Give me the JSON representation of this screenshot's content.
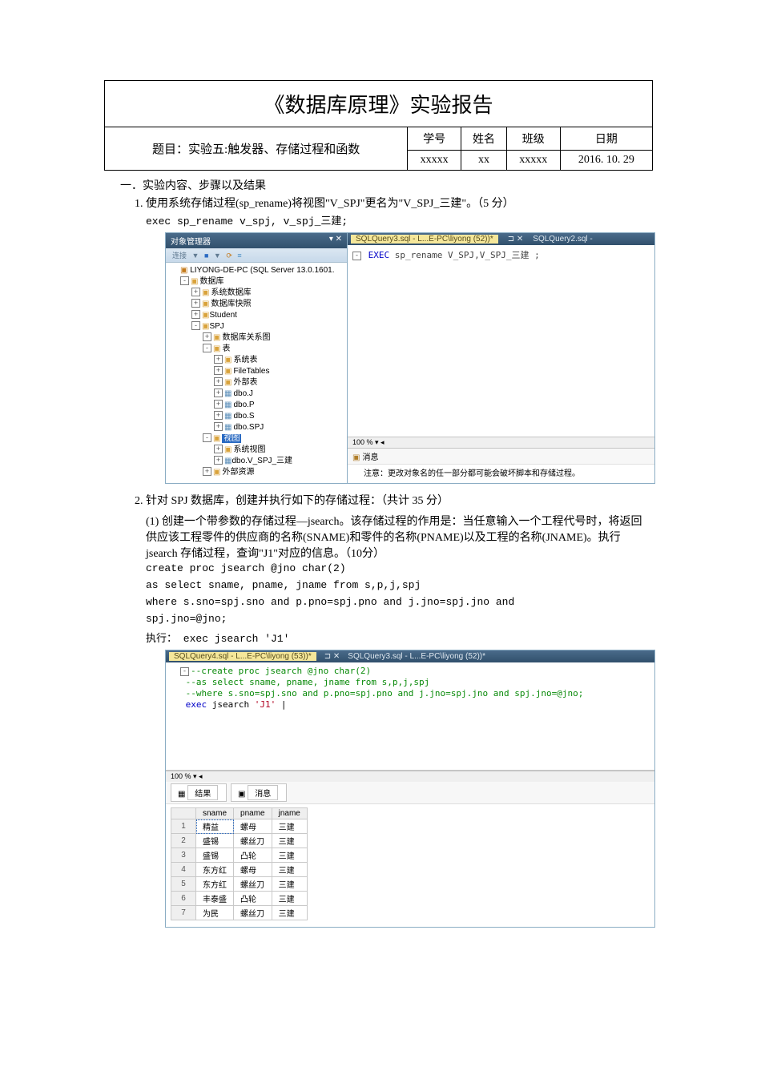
{
  "report": {
    "title": "《数据库原理》实验报告",
    "topic_label": "题目：实验五:触发器、存储过程和函数",
    "col_id": "学号",
    "col_name": "姓名",
    "col_class": "班级",
    "col_date": "日期",
    "val_id": "xxxxx",
    "val_name": "xx",
    "val_class": "xxxxx",
    "val_date": "2016. 10. 29"
  },
  "section1": "一．实验内容、步骤以及结果",
  "q1": {
    "text": "使用系统存储过程(sp_rename)将视图\"V_SPJ\"更名为\"V_SPJ_三建\"。（5 分）",
    "code": "exec sp_rename v_spj,  v_spj_三建;"
  },
  "ssms1": {
    "tree_title": "对象管理器",
    "toolbar_icons": [
      "连接",
      "▼",
      "■",
      "▼",
      "⟳",
      "≡"
    ],
    "server": "LIYONG-DE-PC (SQL Server 13.0.1601.",
    "tree": {
      "db": "数据库",
      "sysdb": "系统数据库",
      "snap": "数据库快照",
      "student": "Student",
      "spj": "SPJ",
      "diagram": "数据库关系图",
      "tables": "表",
      "systables": "系统表",
      "filetables": "FileTables",
      "external": "外部表",
      "dbo_j": "dbo.J",
      "dbo_p": "dbo.P",
      "dbo_s": "dbo.S",
      "dbo_spj": "dbo.SPJ",
      "views": "视图",
      "sysviews": "系统视图",
      "vspj": "dbo.V_SPJ_三建",
      "extres": "外部资源"
    },
    "tab_active": "SQLQuery3.sql - L...E-PC\\liyong (52))*",
    "tab_inactive": "SQLQuery2.sql -",
    "sql_kw": "EXEC",
    "sql_rest": "  sp_rename V_SPJ,V_SPJ_三建 ;",
    "pct": "100 %",
    "msg_tab": "消息",
    "msg_body": "注意：更改对象名的任一部分都可能会破坏脚本和存储过程。"
  },
  "q2": {
    "intro": "针对 SPJ 数据库，创建并执行如下的存储过程：（共计 35 分）",
    "sub1": "(1) 创建一个带参数的存储过程—jsearch。该存储过程的作用是：当任意输入一个工程代号时，将返回供应该工程零件的供应商的名称(SNAME)和零件的名称(PNAME)以及工程的名称(JNAME)。执行 jsearch 存储过程，查询\"J1\"对应的信息。（10分）",
    "code1": "create proc jsearch  @jno char(2)",
    "code2": "as select sname, pname, jname from s,p,j,spj",
    "code3": "where s.sno=spj.sno and p.pno=spj.pno and j.jno=spj.jno and",
    "code4": "spj.jno=@jno;",
    "code5": "执行：  exec jsearch 'J1'"
  },
  "ssms2": {
    "tab_active": "SQLQuery4.sql - L...E-PC\\liyong (53))*",
    "tab_inactive": "SQLQuery3.sql - L...E-PC\\liyong (52))*",
    "editor": {
      "l1": "--create proc jsearch  @jno char(2)",
      "l2": "--as select sname, pname, jname from s,p,j,spj",
      "l3": "--where s.sno=spj.sno and p.pno=spj.pno and j.jno=spj.jno and spj.jno=@jno;",
      "l4a": "exec",
      "l4b": " jsearch ",
      "l4c": "'J1'"
    },
    "pct": "100 %",
    "tab_results": "结果",
    "tab_msg": "消息",
    "columns": [
      "sname",
      "pname",
      "jname"
    ],
    "rows": [
      [
        "精益",
        "螺母",
        "三建"
      ],
      [
        "盛锡",
        "螺丝刀",
        "三建"
      ],
      [
        "盛锡",
        "凸轮",
        "三建"
      ],
      [
        "东方红",
        "螺母",
        "三建"
      ],
      [
        "东方红",
        "螺丝刀",
        "三建"
      ],
      [
        "丰泰盛",
        "凸轮",
        "三建"
      ],
      [
        "为民",
        "螺丝刀",
        "三建"
      ]
    ]
  }
}
